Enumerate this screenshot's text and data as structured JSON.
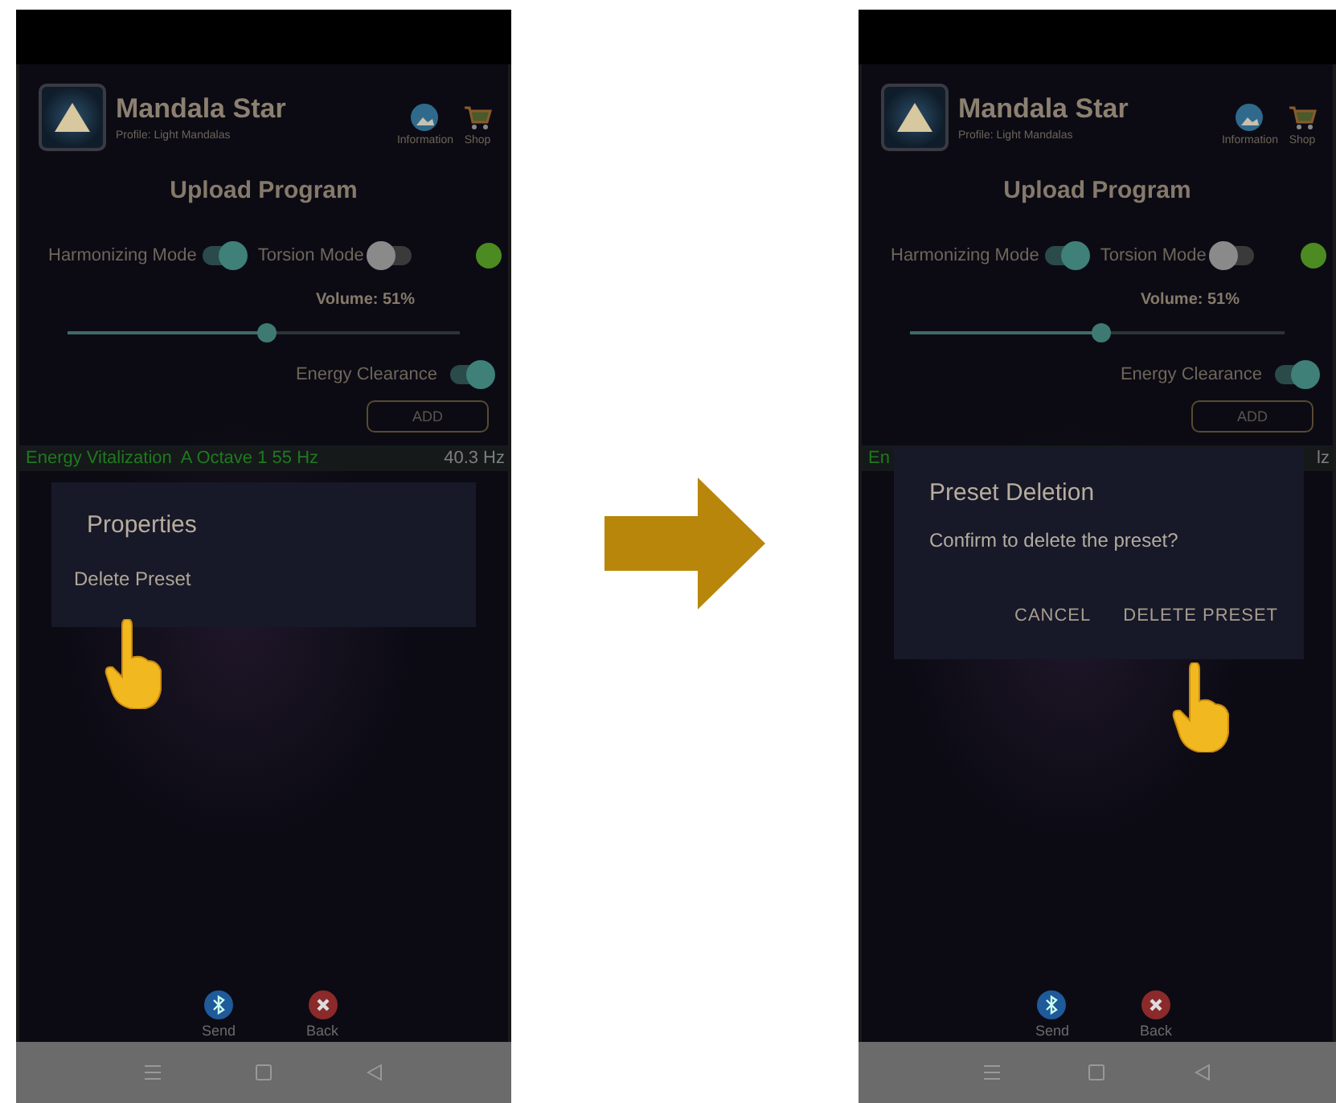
{
  "screens": [
    {
      "app_title": "Mandala Star",
      "profile": "Profile: Light Mandalas",
      "header_buttons": [
        {
          "kind": "info",
          "label": "Information"
        },
        {
          "kind": "shop",
          "label": "Shop"
        }
      ],
      "page_title": "Upload Program",
      "modes": [
        {
          "label": "Harmonizing Mode",
          "on": true
        },
        {
          "label": "Torsion Mode",
          "on": false
        }
      ],
      "volume": {
        "label": "Volume: 51%",
        "level": 0.51
      },
      "energy_clearance": {
        "label": "Energy Clearance",
        "on": true
      },
      "add_button": "ADD",
      "preset": {
        "name": "Energy Vitalization  A Octave 1 55 Hz",
        "frequency": "40.3 Hz"
      },
      "footer_buttons": [
        {
          "kind": "send",
          "label": "Send"
        },
        {
          "kind": "back",
          "label": "Back"
        }
      ],
      "overlay": {
        "kind": "menu",
        "title": "Properties",
        "items": [
          "Delete Preset"
        ]
      }
    },
    {
      "app_title": "Mandala Star",
      "profile": "Profile: Light Mandalas",
      "header_buttons": [
        {
          "kind": "info",
          "label": "Information"
        },
        {
          "kind": "shop",
          "label": "Shop"
        }
      ],
      "page_title": "Upload Program",
      "modes": [
        {
          "label": "Harmonizing Mode",
          "on": true
        },
        {
          "label": "Torsion Mode",
          "on": false
        }
      ],
      "volume": {
        "label": "Volume: 51%",
        "level": 0.51
      },
      "energy_clearance": {
        "label": "Energy Clearance",
        "on": true
      },
      "add_button": "ADD",
      "preset": {
        "name": "En",
        "frequency": "lz"
      },
      "footer_buttons": [
        {
          "kind": "send",
          "label": "Send"
        },
        {
          "kind": "back",
          "label": "Back"
        }
      ],
      "overlay": {
        "kind": "dialog",
        "title": "Preset Deletion",
        "message": "Confirm to delete the preset?",
        "buttons": [
          "CANCEL",
          "DELETE PRESET"
        ]
      }
    }
  ]
}
